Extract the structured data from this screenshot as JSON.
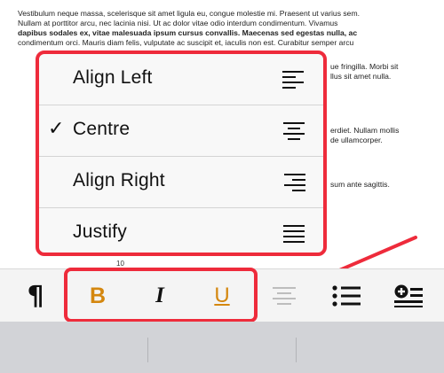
{
  "document": {
    "lines": [
      "Vestibulum neque massa, scelerisque sit amet ligula eu, congue molestie mi. Praesent ut varius sem.",
      "Nullam at porttitor arcu, nec lacinia nisi. Ut ac dolor vitae odio interdum condimentum. Vivamus",
      "dapibus sodales ex, vitae malesuada ipsum cursus convallis. Maecenas sed egestas nulla, ac",
      "condimentum orci. Mauris diam felis, vulputate ac suscipit et, iaculis non est. Curabitur semper arcu"
    ],
    "right_fragments": [
      "ue fringilla. Morbi sit",
      "llus sit amet nulla.",
      "erdiet. Nullam mollis",
      "de ullamcorper.",
      "sum ante sagittis."
    ],
    "page_number": "10"
  },
  "align_menu": {
    "items": [
      {
        "label": "Align Left",
        "icon": "align-left-icon",
        "checked": false
      },
      {
        "label": "Centre",
        "icon": "align-center-icon",
        "checked": true
      },
      {
        "label": "Align Right",
        "icon": "align-right-icon",
        "checked": false
      },
      {
        "label": "Justify",
        "icon": "align-justify-icon",
        "checked": false
      }
    ],
    "check_mark": "✓"
  },
  "toolbar": {
    "paragraph": "¶",
    "bold": "B",
    "italic": "I",
    "underline": "U",
    "align_icon": "align-center-icon",
    "list_icon": "bullet-list-icon",
    "insert_icon": "insert-add-icon"
  },
  "colors": {
    "highlight": "#ee2b3b",
    "format_accent": "#d4870f",
    "align_icon_dim": "#bdbdbd"
  }
}
